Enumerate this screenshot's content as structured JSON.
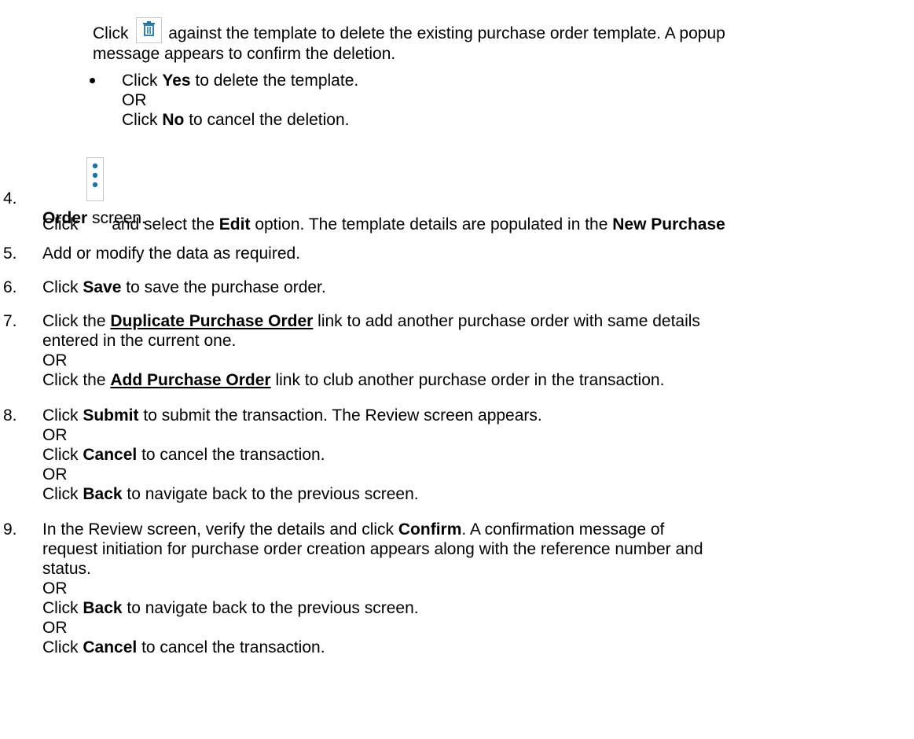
{
  "intro": {
    "click": "Click",
    "text_after_icon": "against the template to delete the existing purchase order template. A popup",
    "text_line2": "message appears to confirm the deletion.",
    "icon": "trash-icon"
  },
  "bullet": {
    "click1": "Click",
    "yes": "Yes",
    "yes_rest": "to delete the template.",
    "or": "OR",
    "click2": "Click",
    "no": "No",
    "no_rest": "to cancel the deletion."
  },
  "steps": {
    "s4": {
      "num": "4.",
      "click": "Click",
      "icon": "kebab-menu-icon",
      "t1": "and select the",
      "edit": "Edit",
      "t2": "option. The template details are populated in the",
      "new_po": "New Purchase",
      "order": "Order",
      "t3": "screen."
    },
    "s5": {
      "num": "5.",
      "text": "Add or modify the data as required."
    },
    "s6": {
      "num": "6.",
      "click": "Click",
      "save": "Save",
      "rest": "to save the purchase order."
    },
    "s7": {
      "num": "7.",
      "click": "Click the",
      "dup_link": "Duplicate Purchase Order",
      "rest1": "link to add another purchase order with same details",
      "line2": "entered in the current one.",
      "or": "OR",
      "click2": "Click the",
      "add_link": "Add Purchase Order",
      "rest2": "link to club another purchase order in the transaction."
    },
    "s8": {
      "num": "8.",
      "click": "Click",
      "submit": "Submit",
      "rest1": "to submit the transaction. The Review screen appears.",
      "or1": "OR",
      "click2": "Click",
      "cancel": "Cancel",
      "rest2": "to cancel the transaction.",
      "or2": "OR",
      "click3": "Click",
      "back": "Back",
      "rest3": "to navigate back to the previous screen."
    },
    "s9": {
      "num": "9.",
      "t1": "In the Review screen, verify the details and click",
      "confirm": "Confirm",
      "t1_end": ". A confirmation message of",
      "line2": "request initiation for purchase order creation appears along with the reference number and",
      "line3": "status.",
      "or1": "OR",
      "click2": "Click",
      "back": "Back",
      "rest2": "to navigate back to the previous screen.",
      "or2": "OR",
      "click3": "Click",
      "cancel": "Cancel",
      "rest3": "to cancel the transaction."
    }
  },
  "colors": {
    "icon_blue": "#1a75a8",
    "icon_border": "#c7c7c7",
    "text": "#000000"
  }
}
